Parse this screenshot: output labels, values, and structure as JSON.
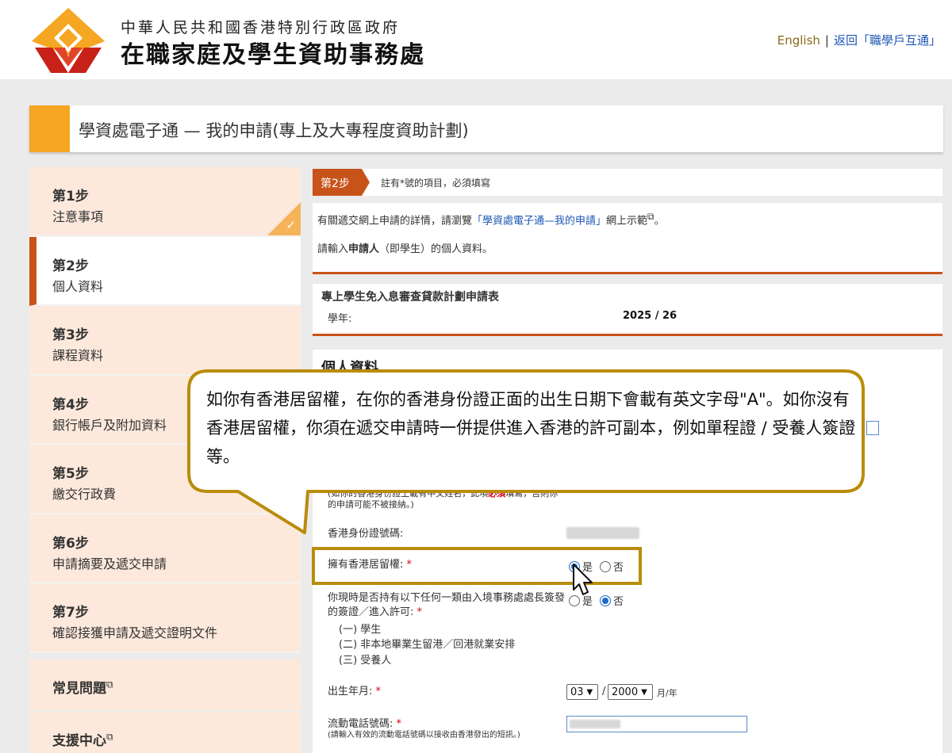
{
  "header": {
    "org_line1": "中華人民共和國香港特別行政區政府",
    "org_line2": "在職家庭及學生資助事務處",
    "link_english": "English",
    "separator": "|",
    "link_back": "返回「職學戶互通」"
  },
  "title_bar": {
    "title": "學資處電子通 — 我的申請(專上及大專程度資助計劃)"
  },
  "sidebar": {
    "steps": [
      {
        "num": "第1步",
        "label": "注意事項",
        "state": "done"
      },
      {
        "num": "第2步",
        "label": "個人資料",
        "state": "active"
      },
      {
        "num": "第3步",
        "label": "課程資料"
      },
      {
        "num": "第4步",
        "label": "銀行帳戶及附加資料"
      },
      {
        "num": "第5步",
        "label": "繳交行政費"
      },
      {
        "num": "第6步",
        "label": "申請摘要及遞交申請"
      },
      {
        "num": "第7步",
        "label": "確認接獲申請及遞交證明文件"
      }
    ],
    "faq": "常見問題",
    "support": "支援中心",
    "checkmark": "✓",
    "external_icon": "⧉"
  },
  "step_bar": {
    "badge": "第2步",
    "note": "註有*號的項目，必須填寫"
  },
  "info": {
    "line1_prefix": "有關遞交網上申請的詳情，請瀏覽",
    "line1_link": "「學資處電子通—我的申請」",
    "line1_suffix": "網上示範",
    "line1_end": "。",
    "line2_prefix": "請輸入",
    "line2_bold": "申請人",
    "line2_suffix": "（即學生）的個人資料。"
  },
  "form_head": {
    "form_title": "專上學生免入息審查貸款計劃申請表",
    "year_label": "學年:",
    "year_value": "2025 / 26"
  },
  "section": {
    "title": "個人資料",
    "note_part1": "(如你的香港身份證上載有中文姓名，此項",
    "note_required": "必須",
    "note_part2": "填寫，否則你的申請可能不被接納。)",
    "hkid_label": "香港身份證號碼:",
    "right_of_abode_label": "擁有香港居留權:",
    "visa_question": "你現時是否持有以下任何一類由入境事務處處長簽發的簽證／進入許可:",
    "visa_option1": "(一) 學生",
    "visa_option2": "(二) 非本地畢業生留港／回港就業安排",
    "visa_option3": "(三) 受養人",
    "dob_label": "出生年月:",
    "dob_month": "03",
    "dob_sep": "/",
    "dob_year": "2000",
    "dob_unit": "月/年",
    "mobile_label": "流動電話號碼:",
    "mobile_note": "(請輸入有效的流動電話號碼以接收由香港發出的短訊。)",
    "yes": "是",
    "no": "否",
    "req_mark": "*"
  },
  "callout": {
    "text": "如你有香港居留權，在你的香港身份證正面的出生日期下會載有英文字母\"A\"。如你沒有香港居留權，你須在遞交申請時一併提供進入香港的許可副本，例如單程證 / 受養人簽證等。"
  },
  "colors": {
    "accent_orange": "#f5a623",
    "step_red": "#c8531a",
    "callout_border": "#b98c0c",
    "link_blue": "#1b56b5"
  }
}
